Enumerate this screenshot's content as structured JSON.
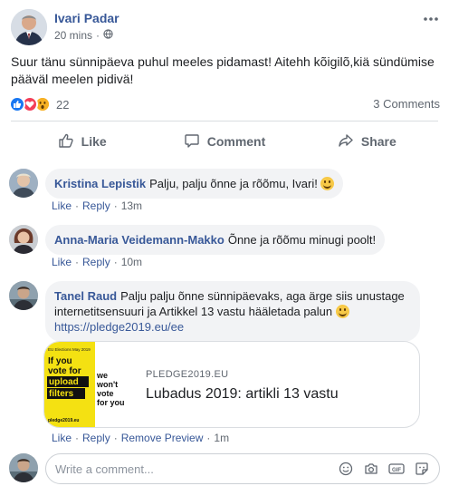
{
  "post": {
    "author": "Ivari Padar",
    "time": "20 mins",
    "more_icon": "more-horizontal-icon",
    "privacy_icon": "globe-icon",
    "text": "Suur tänu sünnipäeva puhul meeles pidamast! Aitehh kõigilõ,kiä sündümise pääväl meelen pidivä!",
    "reactions": [
      "like-reaction-icon",
      "love-reaction-icon",
      "wow-reaction-icon"
    ],
    "reaction_count": "22",
    "comments_count": "3 Comments"
  },
  "actions": {
    "like": "Like",
    "comment": "Comment",
    "share": "Share"
  },
  "comments": [
    {
      "name": "Kristina Lepistik",
      "text": "Palju, palju õnne ja rõõmu, Ivari!",
      "like": "Like",
      "reply": "Reply",
      "time": "13m"
    },
    {
      "name": "Anna-Maria Veidemann-Makko",
      "text": "Õnne ja rõõmu minugi poolt!",
      "like": "Like",
      "reply": "Reply",
      "time": "10m"
    },
    {
      "name": "Tanel Raud",
      "text": "Palju palju õnne sünnipäevaks, aga ärge siis unustage internetitsensuuri ja Artikkel 13 vastu hääletada palun",
      "link": "https://pledge2019.eu/ee",
      "like": "Like",
      "reply": "Reply",
      "remove_preview": "Remove Preview",
      "time": "1m"
    }
  ],
  "link_preview": {
    "domain": "PLEDGE2019.EU",
    "title": "Lubadus 2019: artikli 13 vastu",
    "image_header": "EU Elections May 2019",
    "image_line1": "If you",
    "image_line2": "vote for",
    "image_line3": "upload",
    "image_line4": "filters",
    "image_line5": "we",
    "image_line6": "won't",
    "image_line7": "vote",
    "image_line8": "for you",
    "image_footer": "pledge2019.eu"
  },
  "composer": {
    "placeholder": "Write a comment...",
    "icons": [
      "emoji-icon",
      "camera-icon",
      "gif-icon",
      "sticker-icon"
    ]
  },
  "colors": {
    "link": "#385898",
    "muted": "#606770",
    "like_blue": "#1877f2",
    "love_red": "#f33e58",
    "wow_yellow": "#f7b125",
    "preview_yellow": "#f4e112"
  }
}
